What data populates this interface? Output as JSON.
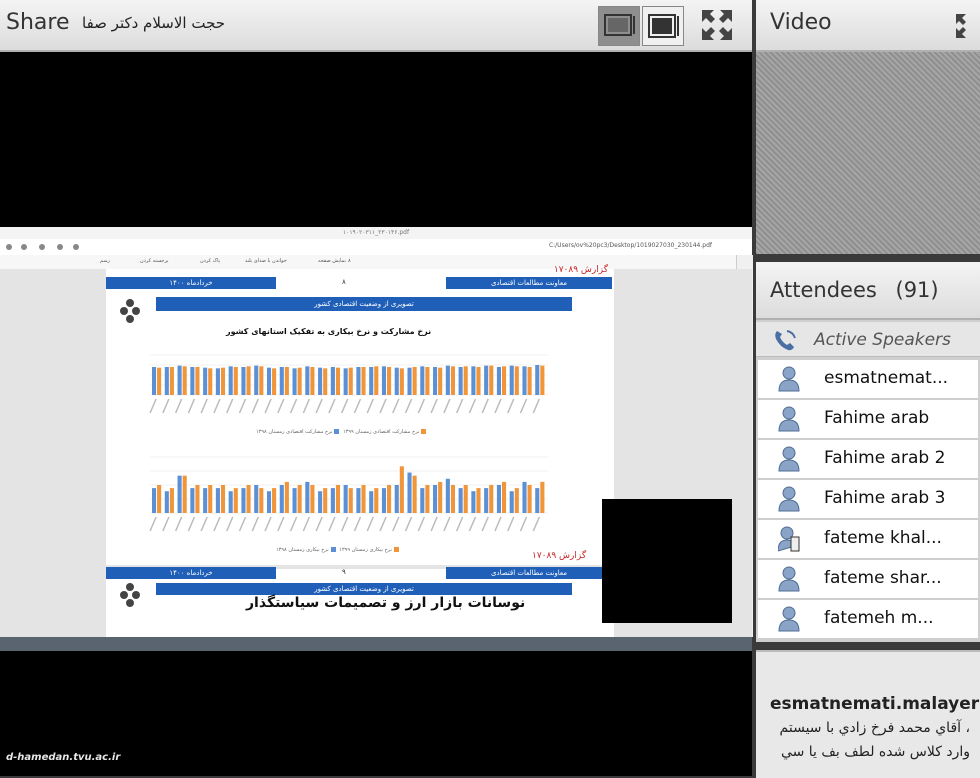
{
  "share": {
    "title": "Share",
    "presenter": "حجت الاسلام دکتر صفا"
  },
  "pdf": {
    "window_title": "۱۰۱۹۰۲۰۳۱۱_۲۳۰۱۴۶.pdf",
    "url": "C:/Users/ov%20pc3/Desktop/1019027030_230144.pdf",
    "toolbar": [
      "رسم",
      "برجسته کردن",
      "پاک کردن",
      "خواندن با صدای بلند",
      "نمایش صفحه",
      "۸"
    ],
    "page1": {
      "org_left": "معاونت مطالعات اقتصادی",
      "date": "خردادماه ۱۴۰۰",
      "page_number": "۸",
      "report_no": "گزارش ۱۷۰۸۹",
      "heading": "تصویری از وضعیت اقتصادی کشور",
      "chart_title": "نرخ مشارکت و نرخ بیکاری به تفکیک استانهای کشور",
      "legend1": [
        "نرخ مشارکت اقتصادی زمستان ۱۳۹۸",
        "نرخ مشارکت اقتصادی زمستان ۱۳۹۹"
      ],
      "legend2": [
        "نرخ بیکاری زمستان ۱۳۹۸",
        "نرخ بیکاری زمستان ۱۳۹۹"
      ]
    },
    "page2": {
      "org_left": "معاونت مطالعات اقتصادی",
      "date": "خردادماه ۱۴۰۰",
      "page_number": "۹",
      "report_no": "گزارش ۱۷۰۸۹",
      "heading": "تصویری از وضعیت اقتصادی کشور",
      "title": "نوسانات بازار ارز و تصمیمات سیاستگذار"
    }
  },
  "colors": {
    "bar_blue": "#5b8fd6",
    "bar_orange": "#f0953a",
    "header_blue": "#1f5fb8"
  },
  "chart_data": [
    {
      "type": "bar",
      "title": "نرخ مشارکت و نرخ بیکاری به تفکیک استانهای کشور",
      "series": [
        {
          "name": "نرخ مشارکت اقتصادی زمستان ۱۳۹۸",
          "values": [
            42,
            42,
            44,
            42,
            41,
            40,
            43,
            42,
            44,
            41,
            42,
            40,
            43,
            41,
            42,
            40,
            42,
            42,
            43,
            41,
            41,
            43,
            42,
            44,
            42,
            43,
            44,
            42,
            44,
            43,
            45
          ]
        },
        {
          "name": "نرخ مشارکت اقتصادی زمستان ۱۳۹۹",
          "values": [
            41,
            42,
            43,
            42,
            40,
            41,
            42,
            43,
            43,
            40,
            42,
            41,
            42,
            40,
            41,
            41,
            42,
            43,
            42,
            40,
            42,
            42,
            41,
            43,
            43,
            42,
            44,
            43,
            43,
            42,
            44
          ]
        }
      ]
    },
    {
      "type": "bar",
      "series": [
        {
          "name": "نرخ بیکاری زمستان ۱۳۹۸",
          "values": [
            8,
            7,
            12,
            8,
            8,
            8,
            7,
            8,
            9,
            7,
            9,
            8,
            10,
            7,
            8,
            9,
            8,
            7,
            8,
            9,
            13,
            8,
            9,
            11,
            8,
            7,
            8,
            9,
            7,
            10,
            8
          ]
        },
        {
          "name": "نرخ بیکاری زمستان ۱۳۹۹",
          "values": [
            9,
            8,
            12,
            9,
            9,
            9,
            8,
            9,
            8,
            8,
            10,
            9,
            9,
            8,
            9,
            8,
            9,
            8,
            9,
            15,
            12,
            9,
            10,
            9,
            9,
            8,
            9,
            10,
            8,
            9,
            10
          ]
        }
      ]
    }
  ],
  "video": {
    "title": "Video"
  },
  "attendees": {
    "title": "Attendees",
    "count": "(91)",
    "active_speakers": "Active Speakers",
    "list": [
      "esmatnemat...",
      "Fahime arab",
      "Fahime arab 2",
      "Fahime arab 3",
      "fateme khal...",
      "fateme shar...",
      "fatemeh m..."
    ]
  },
  "chat": {
    "sender": "esmatnemati.malayer",
    "lines": [
      "، آقاي محمد فرخ زادي با سيستم",
      "وارد كلاس شده لطف بف يا سي"
    ]
  },
  "watermark": "d-hamedan.tvu.ac.ir"
}
